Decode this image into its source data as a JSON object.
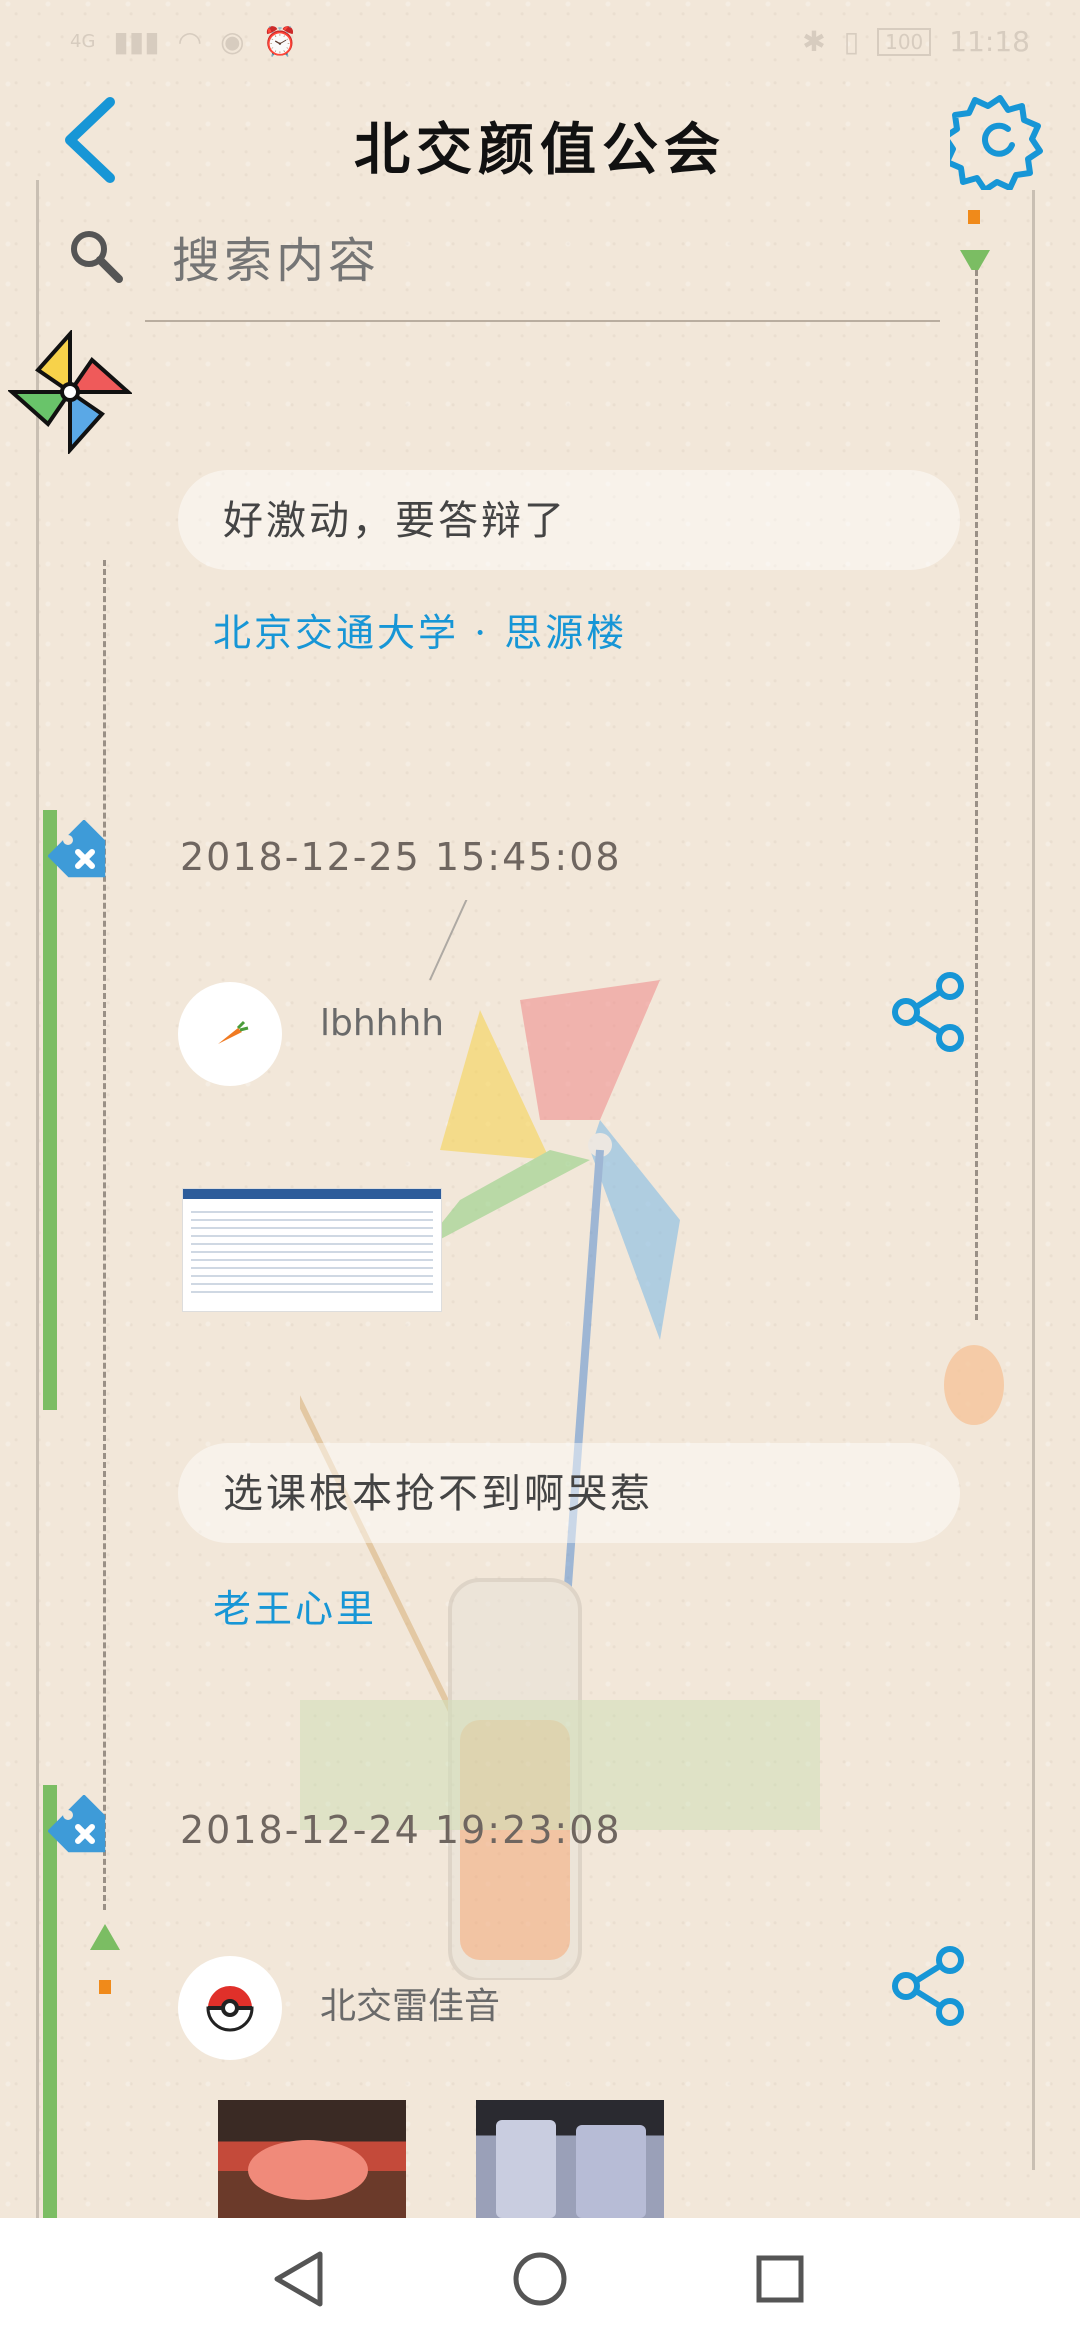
{
  "status_bar": {
    "network": "4G",
    "battery": "100",
    "time": "11:18"
  },
  "header": {
    "title": "北交颜值公会"
  },
  "search": {
    "placeholder": "搜索内容"
  },
  "posts": [
    {
      "text": "好激动，要答辩了",
      "location": "北京交通大学 · 思源楼"
    },
    {
      "timestamp": "2018-12-25 15:45:08",
      "username": "lbhhhh"
    },
    {
      "text": "选课根本抢不到啊哭惹",
      "location": "老王心里"
    },
    {
      "timestamp": "2018-12-24 19:23:08",
      "username": "北交雷佳音"
    }
  ],
  "colors": {
    "accent": "#1796d6",
    "timeline_green": "#7bbd63",
    "background": "#f1e6d8"
  }
}
